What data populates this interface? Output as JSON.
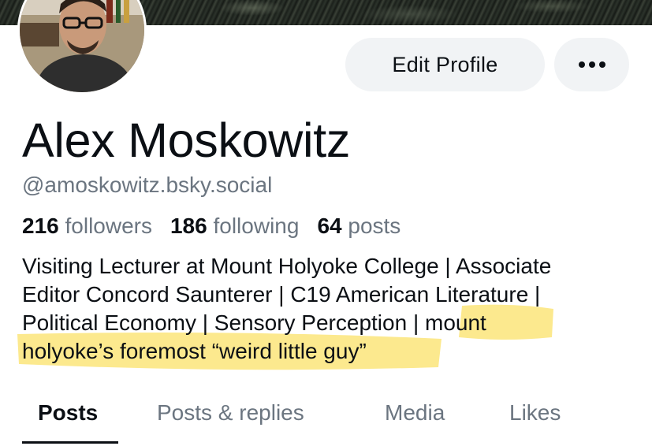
{
  "profile": {
    "display_name": "Alex Moskowitz",
    "handle": "@amoskowitz.bsky.social",
    "stats": [
      {
        "count": "216",
        "label": "followers"
      },
      {
        "count": "186",
        "label": "following"
      },
      {
        "count": "64",
        "label": "posts"
      }
    ],
    "bio_lines": [
      "Visiting Lecturer at Mount Holyoke College | Associate",
      "Editor Concord Saunterer | C19 American Literature |",
      "Political Economy | Sensory Perception | mount",
      "holyoke’s foremost “weird little guy”"
    ]
  },
  "actions": {
    "edit_label": "Edit Profile",
    "more_icon": "more-horizontal-icon"
  },
  "tabs": [
    {
      "label": "Posts",
      "active": true
    },
    {
      "label": "Posts & replies",
      "active": false
    },
    {
      "label": "Media",
      "active": false
    },
    {
      "label": "Likes",
      "active": false
    }
  ],
  "colors": {
    "highlight": "#fbe57a",
    "muted_text": "#6b7580",
    "button_bg": "#f1f3f5"
  }
}
